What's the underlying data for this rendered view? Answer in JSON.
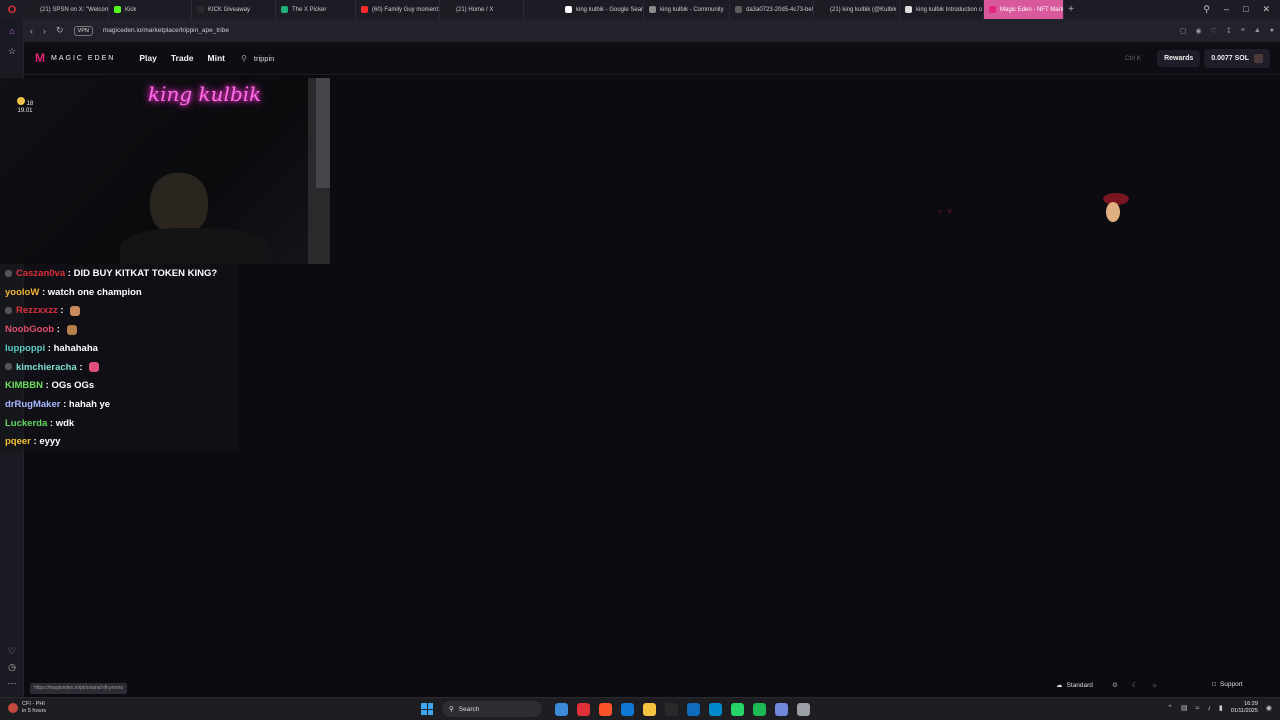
{
  "browser": {
    "tabs": [
      {
        "label": "(21) SPSN on X: \"Welcom",
        "fav": "#1d1d1d",
        "active": false
      },
      {
        "label": "Kick",
        "fav": "#53fc18",
        "active": false
      },
      {
        "label": "KICK Giveaway",
        "fav": "#2a2a2a",
        "active": false
      },
      {
        "label": "The X Picker",
        "fav": "#21b07a",
        "active": false
      },
      {
        "label": "(60) Family Guy moment:",
        "fav": "#ff2b2b",
        "active": false
      },
      {
        "label": "(21) Home / X",
        "fav": "#1d1d1d",
        "active": false
      },
      {
        "label": "king kulbik - Google Sear",
        "fav": "#ffffff",
        "active": false
      },
      {
        "label": "king kulbik - Community",
        "fav": "#8a8a8a",
        "active": false
      },
      {
        "label": "da3a0723-20d5-4c73-be9",
        "fav": "#5c5c5c",
        "active": false
      },
      {
        "label": "(21) king kulbik (@Kulbik",
        "fav": "#1d1d1d",
        "active": false
      },
      {
        "label": "king kulbik Introduction o",
        "fav": "#dddddd",
        "active": false
      },
      {
        "label": "Magic Eden - NFT Market",
        "fav": "#e42575",
        "active": true
      }
    ],
    "vpn_label": "VPN",
    "url": "magiceden.io/marketplace/trippin_ape_tribe"
  },
  "site": {
    "logo_text": "MAGIC EDEN",
    "nav": [
      "Play",
      "Trade",
      "Mint"
    ],
    "search_value": "trippin",
    "search_shortcut": "Ctrl K",
    "rewards_label": "Rewards",
    "wallet_balance": "0.0077 SOL"
  },
  "stream": {
    "neon_sign": "king kulbik",
    "weather_temp": "18",
    "weather_time": "19.01"
  },
  "chat": [
    {
      "user": "Caszan0va",
      "user_color": "#e0303a",
      "message": "DID BUY KITKAT TOKEN KING?",
      "badge": true,
      "emote": null
    },
    {
      "user": "yooloW",
      "user_color": "#f2b533",
      "message": "watch one champion",
      "badge": false,
      "emote": null
    },
    {
      "user": "Rezzxxzz",
      "user_color": "#e0303a",
      "message": "",
      "badge": true,
      "emote": "#c98a5d"
    },
    {
      "user": "NoobGoob",
      "user_color": "#e0506a",
      "message": "",
      "badge": false,
      "emote": "#b3804a"
    },
    {
      "user": "luppoppi",
      "user_color": "#5fd0c4",
      "message": "hahahaha",
      "badge": false,
      "emote": null
    },
    {
      "user": "kimchieracha",
      "user_color": "#7fe0d0",
      "message": "",
      "badge": true,
      "emote": "#e14f7c"
    },
    {
      "user": "KIMBBN",
      "user_color": "#6de05a",
      "message": "OGs OGs",
      "badge": false,
      "emote": null
    },
    {
      "user": "drRugMaker",
      "user_color": "#a9b9ff",
      "message": "hahah ye",
      "badge": false,
      "emote": null
    },
    {
      "user": "Luckerda",
      "user_color": "#63d85f",
      "message": "wdk",
      "badge": false,
      "emote": null
    },
    {
      "user": "pqeer",
      "user_color": "#f2c233",
      "message": "eyyy",
      "badge": false,
      "emote": null
    }
  ],
  "footer": {
    "status_url": "https://magiceden.io/pt/solana/nft-promo",
    "theme_label": "Standard",
    "support_label": "Support"
  },
  "taskbar": {
    "weather_name": "CFI - PHI",
    "weather_sub": "in 5 hours",
    "search_label": "Search",
    "time": "16:29",
    "date": "01/11/2025",
    "app_colors": [
      "#3c8ad8",
      "#e0303a",
      "#fb542b",
      "#0f78d4",
      "#f5c242",
      "#2a2a2a",
      "#0f6cbd",
      "#0088cc",
      "#25d366",
      "#1db954",
      "#7289da",
      "#9aa0a6"
    ]
  }
}
